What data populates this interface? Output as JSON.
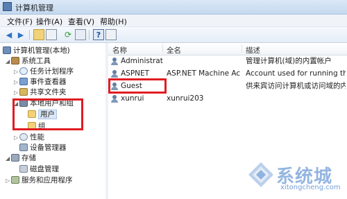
{
  "window": {
    "title": "计算机管理"
  },
  "menu": [
    "文件(F)",
    "操作(A)",
    "查看(V)",
    "帮助(H)"
  ],
  "toolbar": {
    "icons": [
      "back-icon",
      "forward-icon",
      "up-folder-icon",
      "show-hide-tree-icon",
      "refresh-icon",
      "export-icon",
      "help-icon",
      "properties-icon"
    ]
  },
  "tree": {
    "root": "计算机管理(本地)",
    "system_tools": "系统工具",
    "task_scheduler": "任务计划程序",
    "event_viewer": "事件查看器",
    "shared_folders": "共享文件夹",
    "local_users_groups": "本地用户和组",
    "users": "用户",
    "groups": "组",
    "performance": "性能",
    "device_manager": "设备管理器",
    "storage": "存储",
    "disk_management": "磁盘管理",
    "services_apps": "服务和应用程序"
  },
  "list": {
    "columns": [
      "名称",
      "全名",
      "描述"
    ],
    "rows": [
      {
        "name": "Administrat...",
        "full_name": "",
        "description": "管理计算机(域)的内置帐户"
      },
      {
        "name": "ASPNET",
        "full_name": "ASP.NET Machine Acc...",
        "description": "Account used for running the ..."
      },
      {
        "name": "Guest",
        "full_name": "",
        "description": "供来宾访问计算机或访问域的内..."
      },
      {
        "name": "xunrui",
        "full_name": "xunrui203",
        "description": ""
      }
    ]
  },
  "watermark": {
    "brand": "系统城",
    "url": "xitongcheng.com"
  },
  "colors": {
    "highlight_box": "#e01c22",
    "titlebar": "#c4d9f0"
  }
}
